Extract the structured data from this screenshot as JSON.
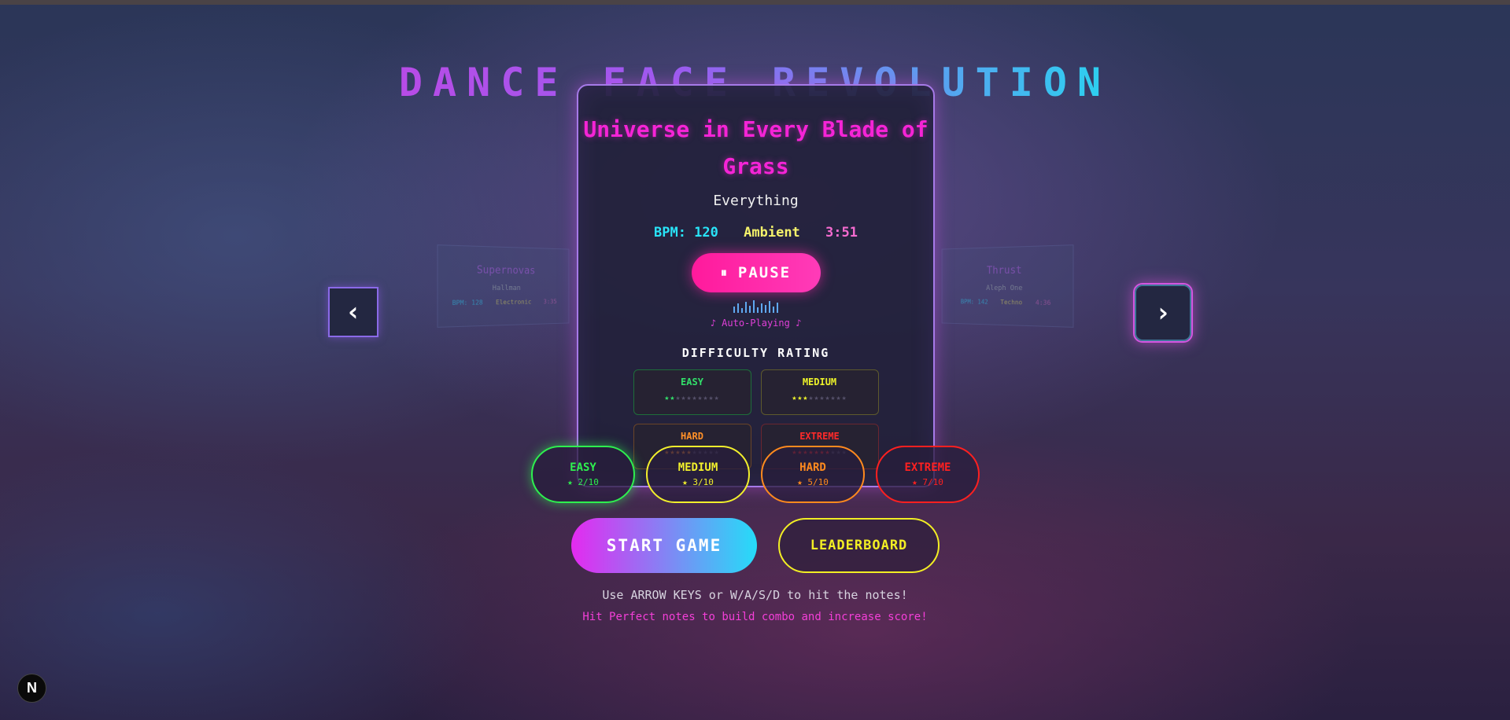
{
  "title": "DANCE FACE REVOLUTION",
  "carousel": {
    "prev_icon": "‹",
    "next_icon": "›",
    "left_song": {
      "title": "Supernovas",
      "artist": "Hallman",
      "bpm": "BPM: 128",
      "genre": "Electronic",
      "duration": "3:35"
    },
    "right_song": {
      "title": "Thrust",
      "artist": "Aleph One",
      "bpm": "BPM: 142",
      "genre": "Techno",
      "duration": "4:36"
    }
  },
  "current_song": {
    "title": "Universe in Every Blade of Grass",
    "artist": "Everything",
    "bpm": "BPM: 120",
    "genre": "Ambient",
    "duration": "3:51",
    "pause_icon": "⏸",
    "pause_label": "PAUSE",
    "status": "♪ Auto-Playing ♪",
    "difficulty_heading": "DIFFICULTY RATING",
    "difficulties": [
      {
        "label": "EASY",
        "stars": "★★",
        "off": "★★★★★★★★"
      },
      {
        "label": "MEDIUM",
        "stars": "★★★",
        "off": "★★★★★★★"
      },
      {
        "label": "HARD",
        "stars": "★★★★★",
        "off": "★★★★★"
      },
      {
        "label": "EXTREME",
        "stars": "★★★★★★★",
        "off": "★★★"
      }
    ]
  },
  "difficulty_selector": [
    {
      "label": "EASY",
      "rating": "★ 2/10"
    },
    {
      "label": "MEDIUM",
      "rating": "★ 3/10"
    },
    {
      "label": "HARD",
      "rating": "★ 5/10"
    },
    {
      "label": "EXTREME",
      "rating": "★ 7/10"
    }
  ],
  "actions": {
    "start_label": "START GAME",
    "leaderboard_label": "LEADERBOARD"
  },
  "instructions": "Use ARROW KEYS or W/A/S/D to hit the notes!",
  "hint": "Hit Perfect notes to build combo and increase score!",
  "badge": "N",
  "colors": {
    "accent_pink": "#f524d6",
    "accent_cyan": "#25dcf8",
    "easy": "#2ef04f",
    "medium": "#f2f02c",
    "hard": "#ff8a1e",
    "extreme": "#ff2020"
  }
}
